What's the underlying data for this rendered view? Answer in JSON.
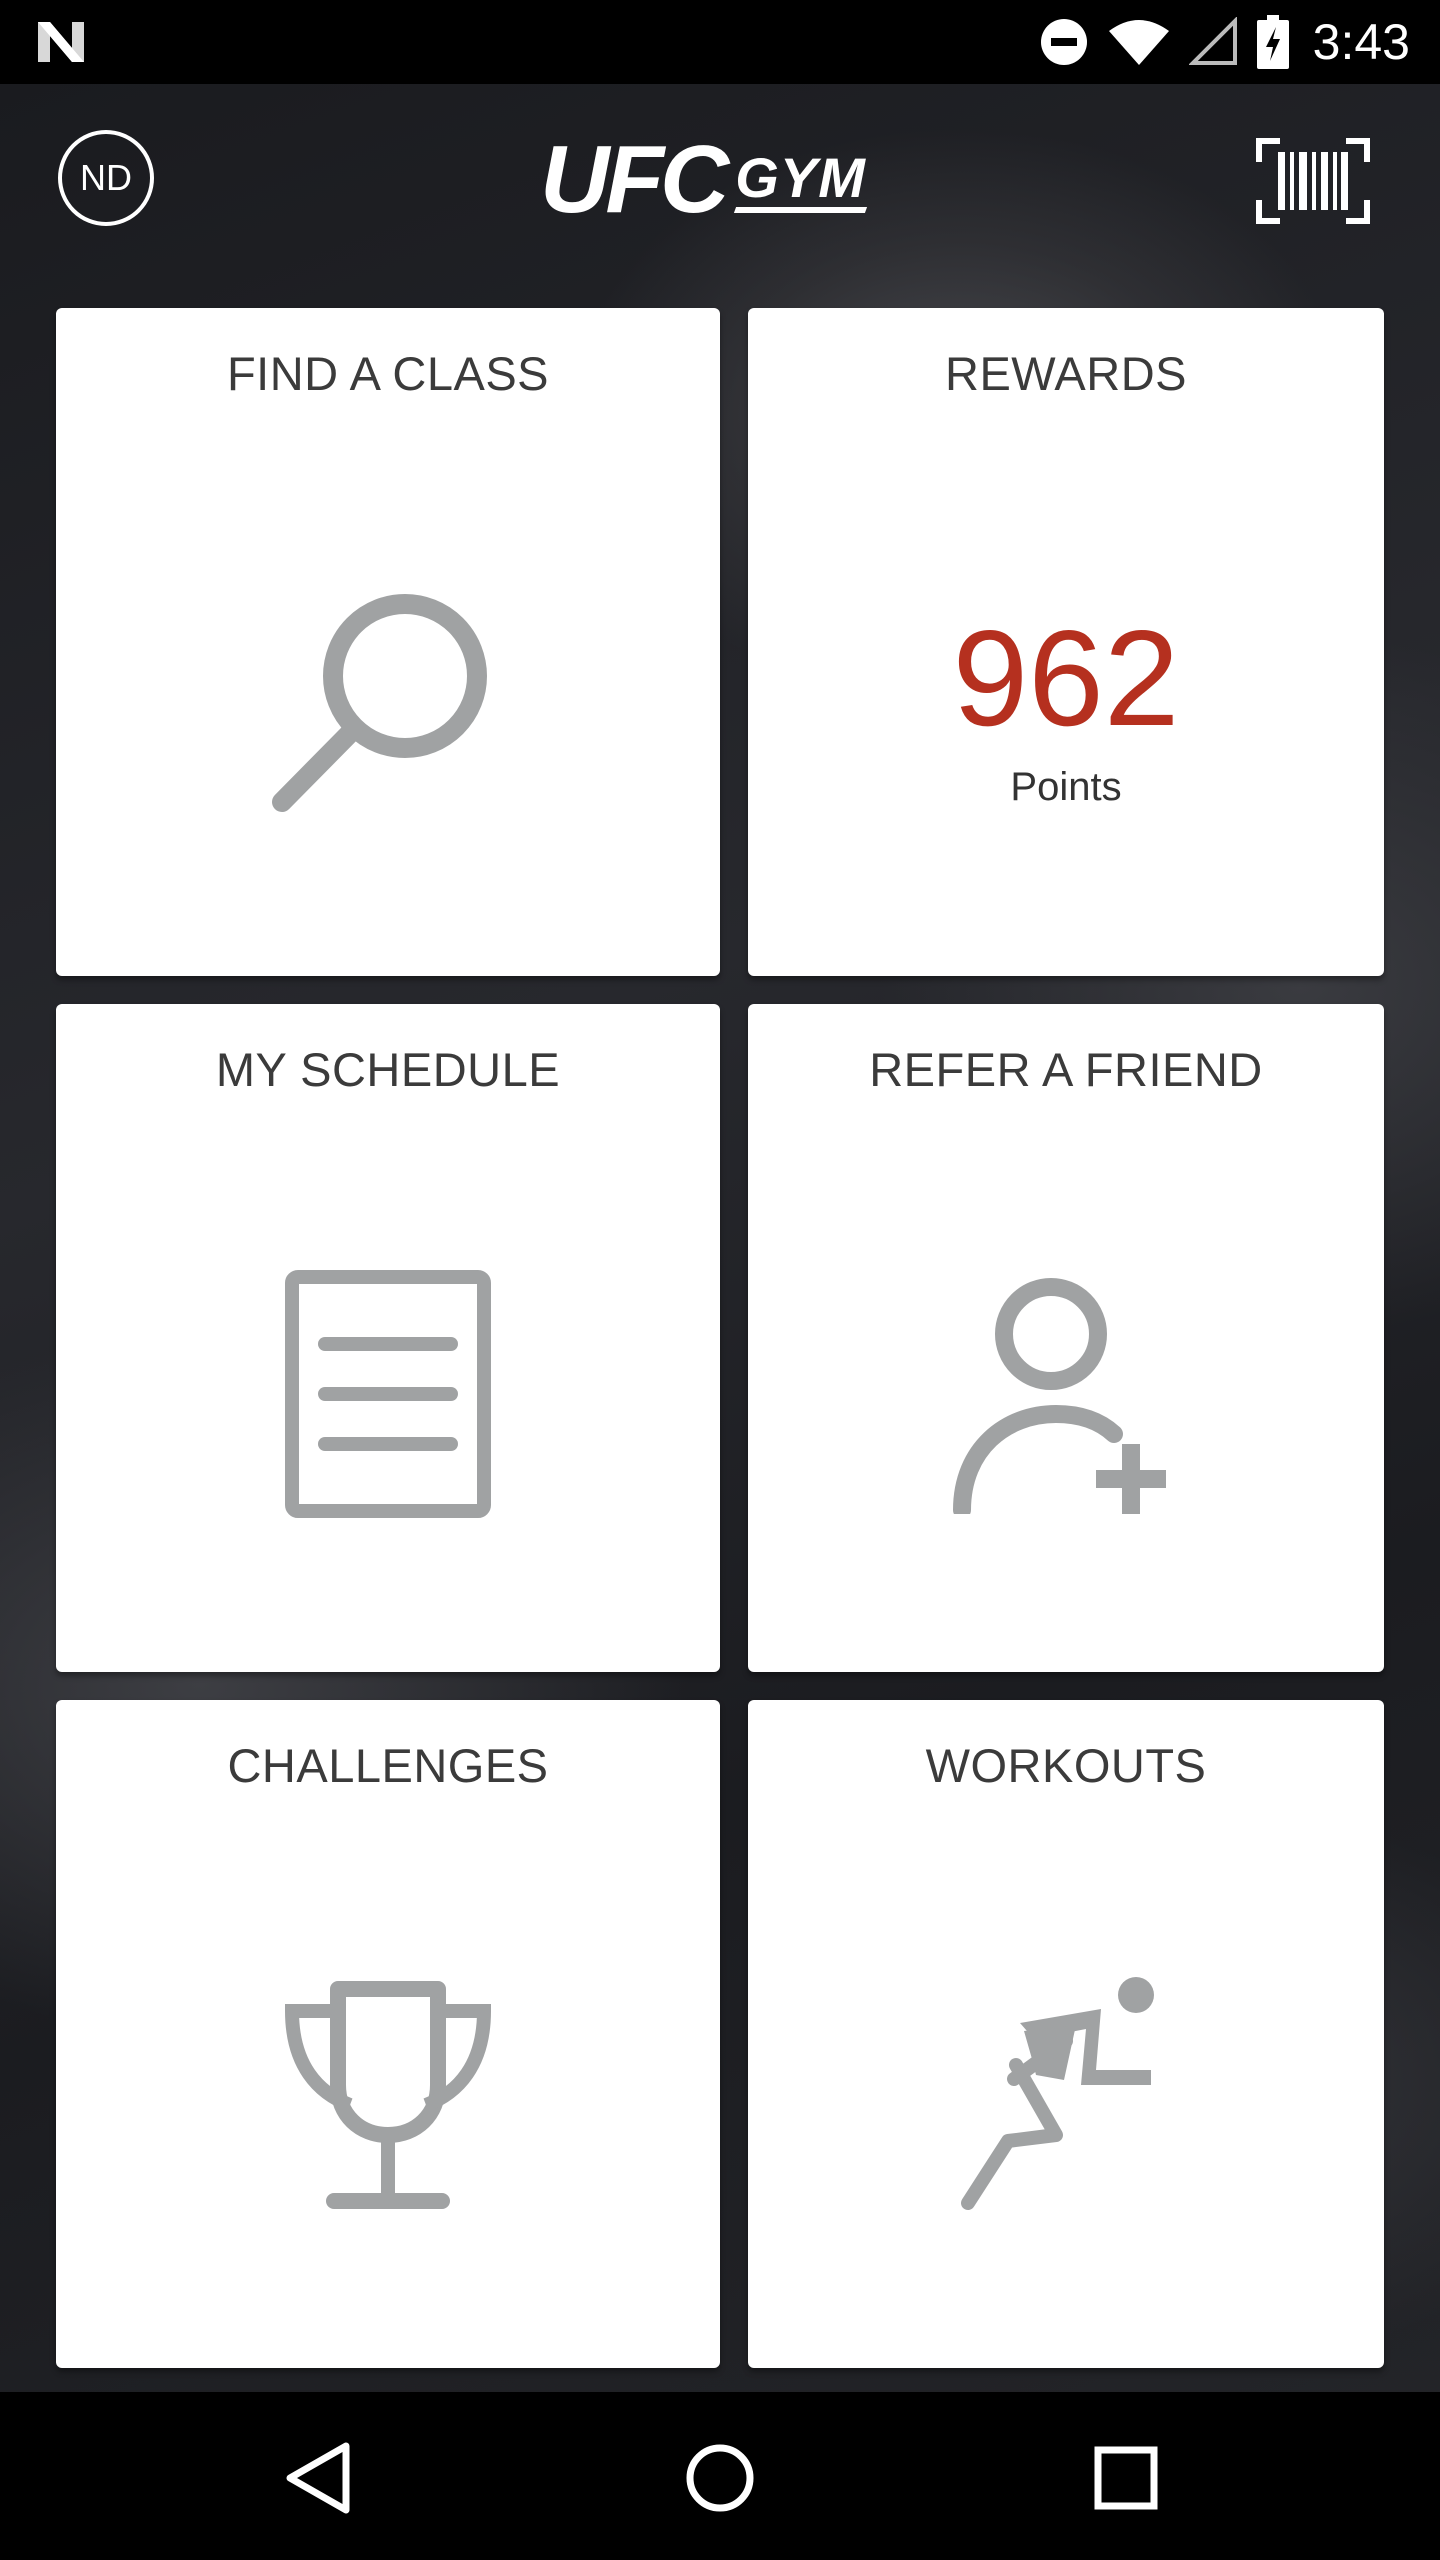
{
  "status_bar": {
    "time": "3:43",
    "icons": [
      "notification-n-icon",
      "do-not-disturb-icon",
      "wifi-icon",
      "cell-signal-icon",
      "battery-charging-icon"
    ]
  },
  "header": {
    "avatar_initials": "ND",
    "logo_primary": "UFC",
    "logo_secondary": "GYM",
    "barcode_icon": "barcode-icon"
  },
  "tiles": {
    "find_class": {
      "title": "FIND A CLASS",
      "icon": "search-icon"
    },
    "rewards": {
      "title": "REWARDS",
      "points": "962",
      "points_label": "Points"
    },
    "my_schedule": {
      "title": "MY SCHEDULE",
      "icon": "document-icon"
    },
    "refer_friend": {
      "title": "REFER A FRIEND",
      "icon": "add-person-icon"
    },
    "challenges": {
      "title": "CHALLENGES",
      "icon": "trophy-icon"
    },
    "workouts": {
      "title": "WORKOUTS",
      "icon": "running-person-icon"
    }
  },
  "colors": {
    "points": "#b5301f",
    "icon_gray": "#a0a2a3",
    "tile_bg": "#ffffff"
  },
  "nav_bar": {
    "back_icon": "back-triangle-icon",
    "home_icon": "home-circle-icon",
    "recents_icon": "recents-square-icon"
  }
}
